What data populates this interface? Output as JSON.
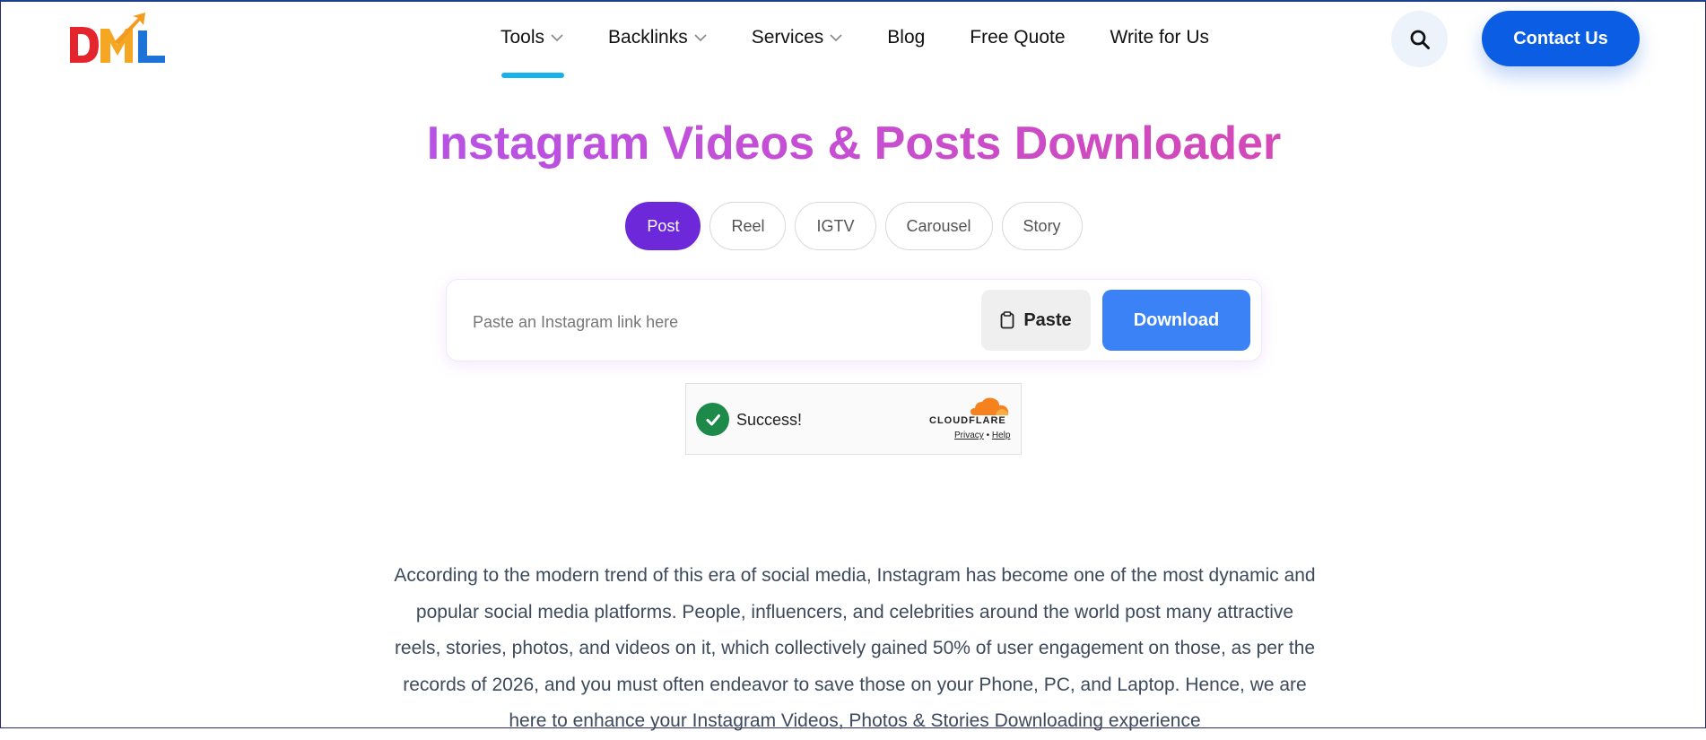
{
  "header": {
    "logo_text": "DML",
    "nav": [
      {
        "label": "Tools",
        "has_dropdown": true,
        "active": true
      },
      {
        "label": "Backlinks",
        "has_dropdown": true
      },
      {
        "label": "Services",
        "has_dropdown": true
      },
      {
        "label": "Blog",
        "has_dropdown": false
      },
      {
        "label": "Free Quote",
        "has_dropdown": false
      },
      {
        "label": "Write for Us",
        "has_dropdown": false
      }
    ],
    "search_icon": "search-icon",
    "contact_label": "Contact Us"
  },
  "main": {
    "title": "Instagram Videos & Posts Downloader",
    "tabs": [
      {
        "label": "Post",
        "active": true
      },
      {
        "label": "Reel"
      },
      {
        "label": "IGTV"
      },
      {
        "label": "Carousel"
      },
      {
        "label": "Story"
      }
    ],
    "input": {
      "value": "",
      "placeholder": "Paste an Instagram link here"
    },
    "paste_label": "Paste",
    "download_label": "Download",
    "captcha": {
      "status": "Success!",
      "brand": "CLOUDFLARE",
      "privacy": "Privacy",
      "separator": "•",
      "help": "Help"
    },
    "paragraph": "According to the modern trend of this era of social media, Instagram has become one of the most dynamic and popular social media platforms. People, influencers, and celebrities around the world post many attractive reels, stories, photos, and videos on it, which collectively gained 50% of user engagement on those, as per the records of 2026, and you must often endeavor to save those on your Phone, PC, and Laptop. Hence, we are here to enhance your Instagram Videos, Photos & Stories Downloading experience"
  },
  "colors": {
    "brand_blue": "#0b5ee3",
    "active_tab": "#6d28d9",
    "download_button": "#3b82f6",
    "nav_underline": "#16b3ea",
    "title_gradient_start": "#a855f7",
    "title_gradient_end": "#e0449c",
    "captcha_check": "#1d8a4a"
  }
}
